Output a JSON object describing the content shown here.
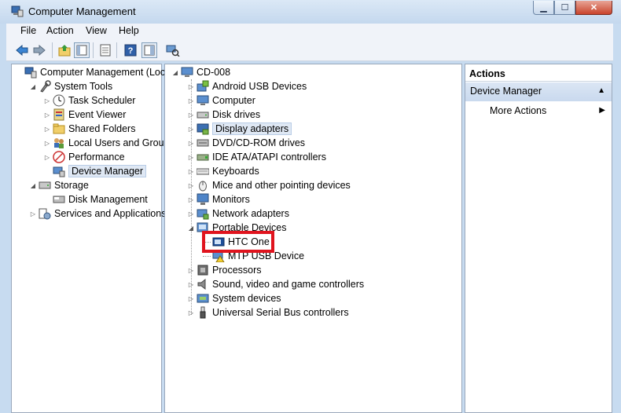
{
  "window": {
    "title": "Computer Management",
    "min": "▁",
    "max": "☐",
    "close": "✕"
  },
  "menu": [
    "File",
    "Action",
    "View",
    "Help"
  ],
  "toolbar": [
    "back-arrow-icon",
    "forward-arrow-icon",
    "up-folder-icon",
    "show-hide-tree-icon",
    "export-list-icon",
    "help-icon",
    "properties-icon",
    "scan-hardware-icon"
  ],
  "left_tree": [
    {
      "label": "Computer Management (Local",
      "icon": "computer-management-icon",
      "level": 0,
      "expander": ""
    },
    {
      "label": "System Tools",
      "icon": "system-tools-icon",
      "level": 1,
      "expander": "◢"
    },
    {
      "label": "Task Scheduler",
      "icon": "clock-icon",
      "level": 2,
      "expander": "▷"
    },
    {
      "label": "Event Viewer",
      "icon": "event-viewer-icon",
      "level": 2,
      "expander": "▷"
    },
    {
      "label": "Shared Folders",
      "icon": "shared-folder-icon",
      "level": 2,
      "expander": "▷"
    },
    {
      "label": "Local Users and Groups",
      "icon": "users-icon",
      "level": 2,
      "expander": "▷"
    },
    {
      "label": "Performance",
      "icon": "performance-icon",
      "level": 2,
      "expander": "▷"
    },
    {
      "label": "Device Manager",
      "icon": "device-manager-icon",
      "level": 2,
      "expander": "",
      "selected": true
    },
    {
      "label": "Storage",
      "icon": "storage-icon",
      "level": 1,
      "expander": "◢"
    },
    {
      "label": "Disk Management",
      "icon": "disk-icon",
      "level": 2,
      "expander": ""
    },
    {
      "label": "Services and Applications",
      "icon": "services-icon",
      "level": 1,
      "expander": "▷"
    }
  ],
  "device_tree": {
    "root": "CD-008",
    "items": [
      {
        "label": "Android USB Devices",
        "icon": "android-usb-icon",
        "expander": "▷"
      },
      {
        "label": "Computer",
        "icon": "computer-icon",
        "expander": "▷"
      },
      {
        "label": "Disk drives",
        "icon": "disk-drive-icon",
        "expander": "▷"
      },
      {
        "label": "Display adapters",
        "icon": "display-adapter-icon",
        "expander": "▷",
        "selected": true
      },
      {
        "label": "DVD/CD-ROM drives",
        "icon": "dvd-icon",
        "expander": "▷"
      },
      {
        "label": "IDE ATA/ATAPI controllers",
        "icon": "ide-controller-icon",
        "expander": "▷"
      },
      {
        "label": "Keyboards",
        "icon": "keyboard-icon",
        "expander": "▷"
      },
      {
        "label": "Mice and other pointing devices",
        "icon": "mouse-icon",
        "expander": "▷"
      },
      {
        "label": "Monitors",
        "icon": "monitor-icon",
        "expander": "▷"
      },
      {
        "label": "Network adapters",
        "icon": "network-adapter-icon",
        "expander": "▷"
      },
      {
        "label": "Portable Devices",
        "icon": "portable-device-icon",
        "expander": "◢"
      },
      {
        "label": "HTC One",
        "icon": "phone-icon",
        "child": true
      },
      {
        "label": "MTP USB Device",
        "icon": "warning-device-icon",
        "child": true
      },
      {
        "label": "Processors",
        "icon": "processor-icon",
        "expander": "▷"
      },
      {
        "label": "Sound, video and game controllers",
        "icon": "speaker-icon",
        "expander": "▷"
      },
      {
        "label": "System devices",
        "icon": "system-device-icon",
        "expander": "▷"
      },
      {
        "label": "Universal Serial Bus controllers",
        "icon": "usb-icon",
        "expander": "▷"
      }
    ]
  },
  "actions": {
    "header": "Actions",
    "section": "Device Manager",
    "section_arrow": "▲",
    "more": "More Actions",
    "more_arrow": "▶"
  }
}
